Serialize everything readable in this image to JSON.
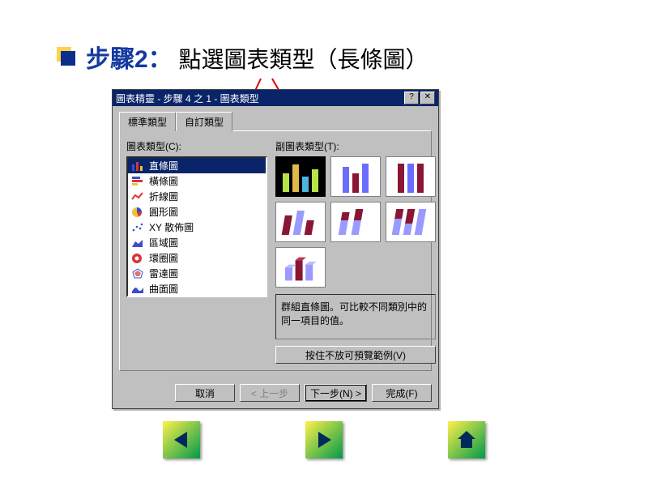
{
  "slide": {
    "step_label": "步驟2：",
    "instruction": "點選圖表類型（長條圖）"
  },
  "dialog": {
    "title": "圖表精靈 - 步驟 4 之 1 - 圖表類型",
    "help_btn": "?",
    "close_btn": "✕",
    "tabs": {
      "standard": "標準類型",
      "custom": "自訂類型"
    },
    "left_label": "圖表類型(C):",
    "right_label": "副圖表類型(T):",
    "types": [
      "直條圖",
      "橫條圖",
      "折線圖",
      "圓形圖",
      "XY 散佈圖",
      "區域圖",
      "環圈圖",
      "雷達圖",
      "曲面圖"
    ],
    "selected_index": 0,
    "description": "群組直條圖。可比較不同類別中的同一項目的值。",
    "preview_button": "按住不放可預覽範例(V)",
    "buttons": {
      "cancel": "取消",
      "back": "< 上一步",
      "next": "下一步(N) >",
      "finish": "完成(F)"
    }
  }
}
